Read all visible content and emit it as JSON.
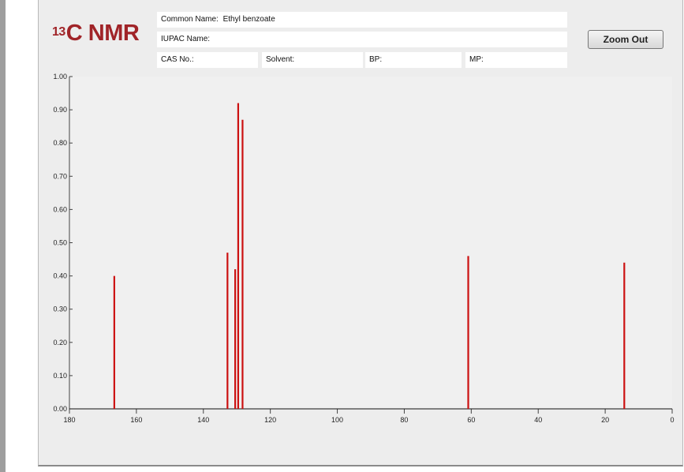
{
  "page": {
    "title_sup": "13",
    "title_main": "C NMR",
    "zoom_label": "Zoom Out"
  },
  "info": {
    "common_name_label": "Common Name:",
    "common_name_value": "Ethyl benzoate",
    "iupac_label": "IUPAC Name:",
    "iupac_value": "",
    "cas_label": "CAS No.:",
    "cas_value": "",
    "solvent_label": "Solvent:",
    "solvent_value": "",
    "bp_label": "BP:",
    "bp_value": "",
    "mp_label": "MP:",
    "mp_value": ""
  },
  "colors": {
    "title": "#a02428",
    "peak": "#cc1111",
    "panel_bg": "#ededed",
    "plot_bg": "#f0f0f0"
  },
  "chart_data": {
    "type": "bar",
    "title": "13C NMR",
    "xlabel": "",
    "ylabel": "",
    "xlim": [
      180,
      0
    ],
    "ylim": [
      0,
      1.0
    ],
    "x_reversed": true,
    "x_ticks": [
      "180",
      "160",
      "140",
      "120",
      "100",
      "80",
      "60",
      "40",
      "20",
      "0"
    ],
    "y_ticks": [
      "0.00",
      "0.10",
      "0.20",
      "0.30",
      "0.40",
      "0.50",
      "0.60",
      "0.70",
      "0.80",
      "0.90",
      "1.00"
    ],
    "grid": false,
    "peaks": [
      {
        "shift": 166.6,
        "intensity": 0.4
      },
      {
        "shift": 132.8,
        "intensity": 0.47
      },
      {
        "shift": 130.5,
        "intensity": 0.42
      },
      {
        "shift": 129.6,
        "intensity": 0.92
      },
      {
        "shift": 128.3,
        "intensity": 0.87
      },
      {
        "shift": 60.9,
        "intensity": 0.46
      },
      {
        "shift": 14.3,
        "intensity": 0.44
      }
    ]
  }
}
